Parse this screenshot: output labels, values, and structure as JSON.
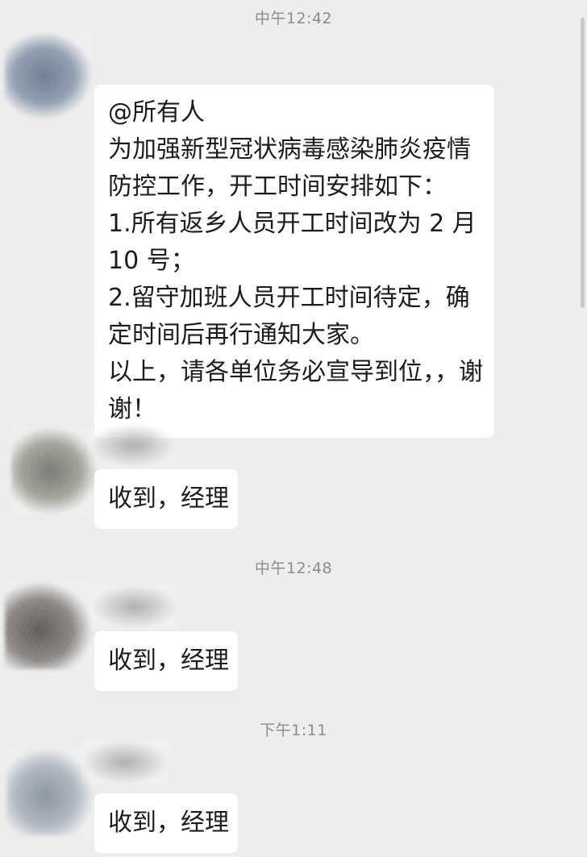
{
  "messages": [
    {
      "time": "中午12:42"
    },
    {
      "lines": [
        "@所有人",
        "为加强新型冠状病毒感染肺炎疫情",
        "防控工作，开工时间安排如下：",
        "1.所有返乡人员开工时间改为 2 月",
        "10 号；",
        "2.留守加班人员开工时间待定，确",
        "定时间后再行通知大家。",
        "以上，请各单位务必宣导到位，，谢",
        "谢！"
      ]
    },
    {
      "text": "收到，经理"
    },
    {
      "time": "中午12:48"
    },
    {
      "text": "收到，经理"
    },
    {
      "time": "下午1:11"
    },
    {
      "text": "收到，经理"
    }
  ]
}
